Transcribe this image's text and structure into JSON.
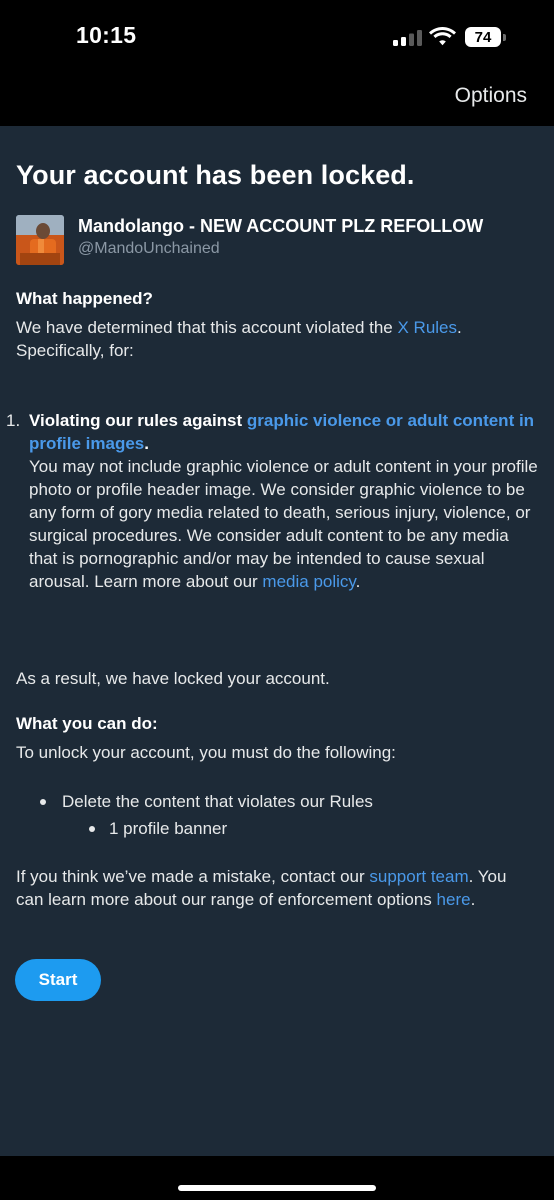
{
  "status_bar": {
    "time": "10:15",
    "battery_level": "74"
  },
  "nav": {
    "options_label": "Options"
  },
  "page": {
    "title": "Your account has been locked."
  },
  "account": {
    "display_name": "Mandolango - NEW ACCOUNT PLZ REFOLLOW",
    "handle": "@MandoUnchained"
  },
  "what_happened": {
    "heading": "What happened?",
    "text_before_link": "We have determined that this account violated the ",
    "rules_link": "X Rules",
    "text_after_link": ".",
    "line2": "Specifically, for:"
  },
  "violation": {
    "number": "1.",
    "lead_bold": "Violating our rules against ",
    "lead_link": "graphic violence or adult content in profile images",
    "lead_end": ".",
    "description": "You may not include graphic violence or adult content in your profile photo or profile header image. We consider graphic violence to be any form of gory media related to death, serious injury, violence, or surgical procedures. We consider adult content to be any media that is pornographic and/or may be intended to cause sexual arousal. Learn more about our ",
    "policy_link": "media policy",
    "description_end": "."
  },
  "result": {
    "text": "As a result, we have locked your account."
  },
  "what_you_can_do": {
    "heading": "What you can do:",
    "intro": "To unlock your account, you must do the following:",
    "action_item": "Delete the content that violates our Rules",
    "sub_item": "1 profile banner"
  },
  "mistake": {
    "text_before_link": "If you think we’ve made a mistake, contact our ",
    "support_link": "support team",
    "text_middle": ". You can learn more about our range of enforcement options ",
    "here_link": "here",
    "text_end": "."
  },
  "actions": {
    "start_label": "Start"
  },
  "colors": {
    "background": "#1d2a37",
    "link": "#4a99e9",
    "button": "#1d9bf0"
  },
  "icons": [
    "cellular-signal-icon",
    "wifi-icon",
    "battery-icon"
  ]
}
